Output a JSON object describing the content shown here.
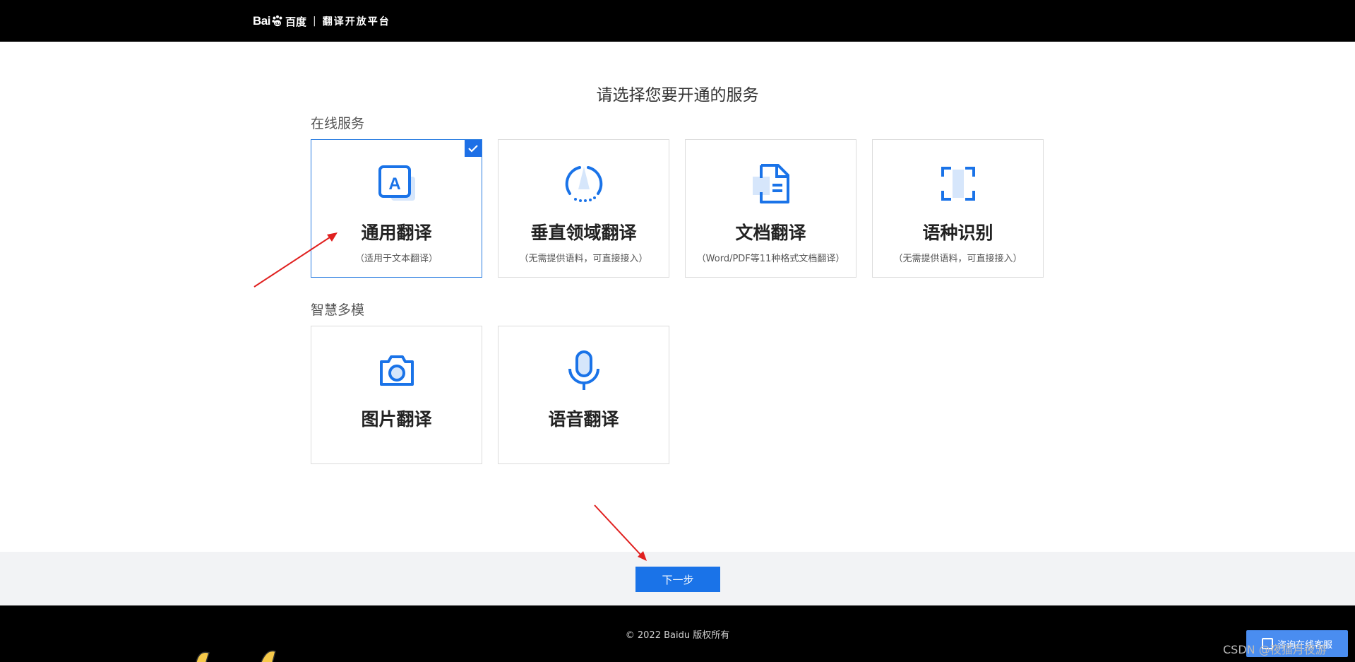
{
  "header": {
    "logo_text": "Bai",
    "logo_cn": "百度",
    "separator": "|",
    "platform_name": "翻译开放平台"
  },
  "main": {
    "title": "请选择您要开通的服务",
    "sections": [
      {
        "label": "在线服务",
        "cards": [
          {
            "name": "通用翻译",
            "desc": "（适用于文本翻译）",
            "icon": "text-translate-icon",
            "selected": true
          },
          {
            "name": "垂直领域翻译",
            "desc": "（无需提供语料，可直接接入）",
            "icon": "domain-translate-icon",
            "selected": false
          },
          {
            "name": "文档翻译",
            "desc": "（Word/PDF等11种格式文档翻译）",
            "icon": "document-translate-icon",
            "selected": false
          },
          {
            "name": "语种识别",
            "desc": "（无需提供语料，可直接接入）",
            "icon": "language-detect-icon",
            "selected": false
          }
        ]
      },
      {
        "label": "智慧多模",
        "cards": [
          {
            "name": "图片翻译",
            "desc": "",
            "icon": "camera-icon",
            "selected": false
          },
          {
            "name": "语音翻译",
            "desc": "",
            "icon": "microphone-icon",
            "selected": false
          }
        ]
      }
    ]
  },
  "actions": {
    "next_label": "下一步"
  },
  "footer": {
    "copyright": "© 2022 Baidu 版权所有",
    "chat_label": "咨询在线客服",
    "watermark": "CSDN @夜猫月夜游"
  },
  "colors": {
    "accent": "#1a73e8",
    "topbar": "#000000",
    "annotation_arrow": "#e0201f"
  }
}
